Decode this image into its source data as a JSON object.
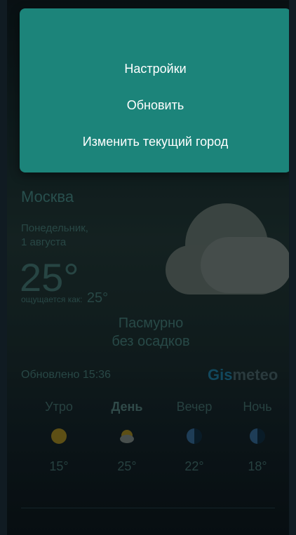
{
  "menu": {
    "items": [
      "Настройки",
      "Обновить",
      "Изменить текущий город"
    ]
  },
  "weather": {
    "city": "Москва",
    "date_line1": "Понедельник,",
    "date_line2": "1 августа",
    "temperature": "25°",
    "feels_label": "ощущается как:",
    "feels_value": "25°",
    "condition_line1": "Пасмурно",
    "condition_line2": "без осадков",
    "icon": "cloud-icon"
  },
  "footer": {
    "updated": "Обновлено 15:36",
    "logo_part1": "Gis",
    "logo_part2": "meteo"
  },
  "forecast": [
    {
      "label": "Утро",
      "temp": "15°",
      "icon": "sun-icon",
      "bold": false
    },
    {
      "label": "День",
      "temp": "25°",
      "icon": "partly-cloudy-icon",
      "bold": true
    },
    {
      "label": "Вечер",
      "temp": "22°",
      "icon": "moon-icon",
      "bold": false
    },
    {
      "label": "Ночь",
      "temp": "18°",
      "icon": "moon-icon",
      "bold": false
    }
  ],
  "colors": {
    "menu_background": "#1c847a",
    "accent_logo": "#1d6f8f"
  }
}
